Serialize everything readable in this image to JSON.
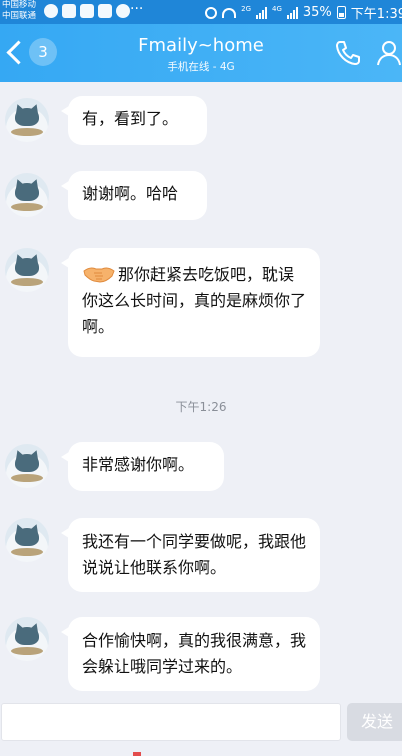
{
  "status_bar": {
    "carrier_1": "中国移动",
    "carrier_2": "中国联通",
    "network_small": "2G",
    "network_4g": "4G",
    "battery": "35%",
    "time": "下午1:39",
    "icons": [
      "qq-icon",
      "messenger-icon",
      "notes-icon",
      "photo-icon",
      "qq-browser-icon",
      "more-icon",
      "alarm-icon",
      "wifi-icon",
      "signal-icon",
      "battery-icon"
    ]
  },
  "header": {
    "back_badge": "3",
    "title": "Fmaily~home",
    "subtitle": "手机在线 - 4G",
    "accent": "#35a8f3"
  },
  "messages": [
    {
      "text": "有，看到了。"
    },
    {
      "text": "谢谢啊。哈哈"
    },
    {
      "text": "那你赶紧去吃饭吧，耽误你这么长时间，真的是麻烦你了啊。",
      "emoji": "handshake"
    },
    {
      "text": "非常感谢你啊。"
    },
    {
      "text": "我还有一个同学要做呢，我跟他说说让他联系你啊。"
    },
    {
      "text": "合作愉快啊，真的我很满意，我会躲让哦同学过来的。"
    }
  ],
  "timestamp": "下午1:26",
  "composer": {
    "placeholder": "",
    "send_label": "发送"
  }
}
